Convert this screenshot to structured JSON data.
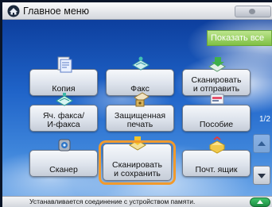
{
  "titlebar": {
    "title": "Главное меню"
  },
  "show_all_label": "Показать все",
  "tiles": [
    {
      "label": "Копия",
      "icon": "copy-icon"
    },
    {
      "label": "Факс",
      "icon": "fax-icon"
    },
    {
      "label": "Сканировать\nи отправить",
      "icon": "scan-send-icon"
    },
    {
      "label": "Яч. факса/\nИ-факса",
      "icon": "fax-inbox-icon"
    },
    {
      "label": "Защищенная\nпечать",
      "icon": "secure-print-icon"
    },
    {
      "label": "Пособие",
      "icon": "tutorial-icon"
    },
    {
      "label": "Сканер",
      "icon": "scanner-icon"
    },
    {
      "label": "Сканировать\nи сохранить",
      "icon": "scan-store-icon",
      "selected": true
    },
    {
      "label": "Почт. ящик",
      "icon": "mailbox-icon"
    }
  ],
  "page_indicator": "1/2",
  "status": {
    "message": "Устанавливается соединение с устройством памяти."
  },
  "colors": {
    "highlight": "#f19a2c",
    "show_all": "#8fcd52",
    "status_button": "#2aa855"
  }
}
